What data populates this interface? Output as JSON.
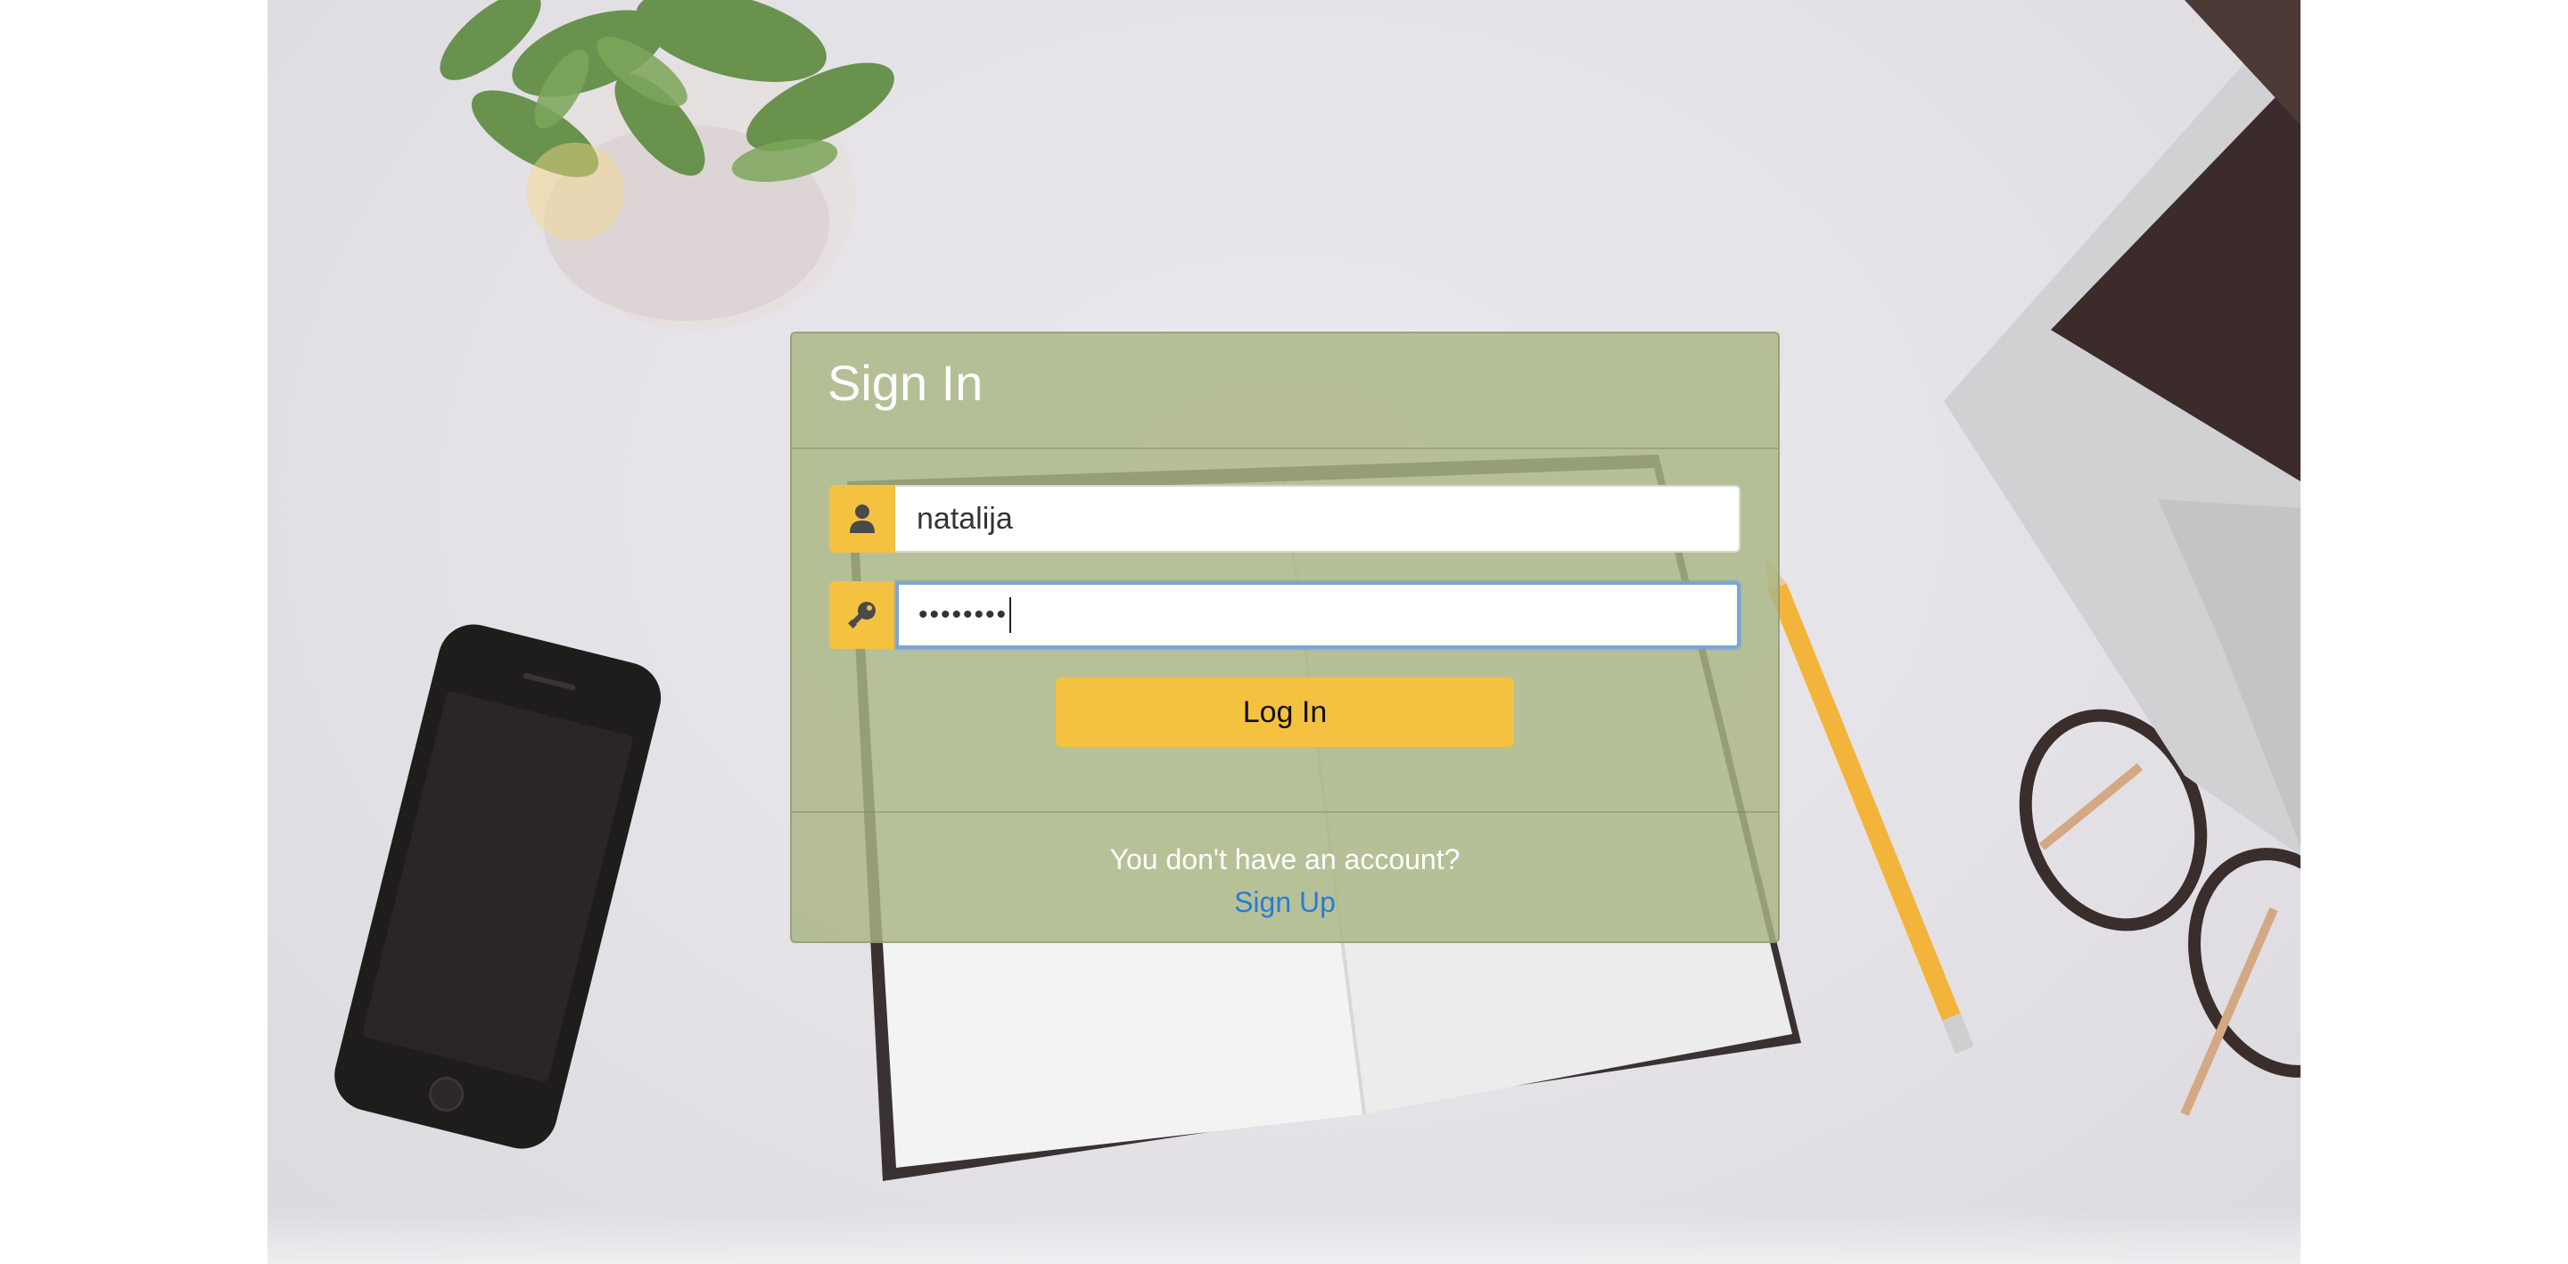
{
  "signin": {
    "title": "Sign In",
    "username": {
      "value": "natalija",
      "icon": "user-icon"
    },
    "password": {
      "masked_value": "••••••••",
      "icon": "key-icon"
    },
    "login_button_label": "Log In",
    "footer_text": "You don't have an account?",
    "signup_link_label": "Sign Up"
  },
  "colors": {
    "card_background": "#a9b684",
    "accent_yellow": "#f5c141",
    "link_blue": "#2a7bd8",
    "focus_border": "#7aa4d6"
  }
}
